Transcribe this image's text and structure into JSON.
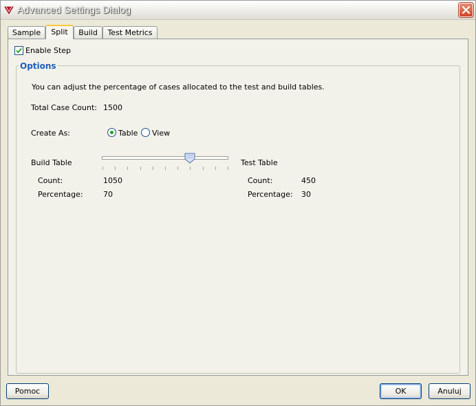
{
  "window": {
    "title": "Advanced Settings Dialog"
  },
  "tabs": [
    {
      "label": "Sample"
    },
    {
      "label": "Split",
      "active": true
    },
    {
      "label": "Build"
    },
    {
      "label": "Test Metrics"
    }
  ],
  "enable_step": {
    "label": "Enable Step",
    "checked": true
  },
  "options": {
    "title": "Options",
    "description": "You can adjust the percentage of cases allocated to the test and build tables.",
    "total_case_count_label": "Total Case Count:",
    "total_case_count_value": "1500",
    "create_as_label": "Create As:",
    "create_as_options": [
      {
        "label": "Table",
        "selected": true
      },
      {
        "label": "View",
        "selected": false
      }
    ]
  },
  "split": {
    "slider_percent": 70,
    "build": {
      "title": "Build Table",
      "count_label": "Count:",
      "count_value": "1050",
      "percentage_label": "Percentage:",
      "percentage_value": "70"
    },
    "test": {
      "title": "Test Table",
      "count_label": "Count:",
      "count_value": "450",
      "percentage_label": "Percentage:",
      "percentage_value": "30"
    }
  },
  "buttons": {
    "help": "Pomoc",
    "ok": "OK",
    "cancel": "Anuluj"
  },
  "icons": {
    "app": "app-logo-icon",
    "close": "close-icon",
    "check": "checkmark-icon"
  },
  "colors": {
    "accent": "#1e5fbc",
    "dialog_bg": "#ece9d8",
    "close_btn": "#d0452a",
    "tab_highlight": "#ffc83c"
  }
}
